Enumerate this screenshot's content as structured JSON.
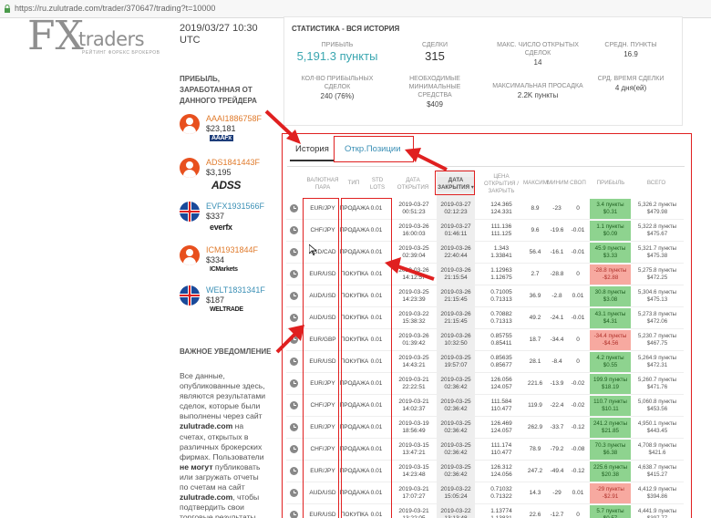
{
  "browser": {
    "url": "https://ru.zulutrade.com/trader/370647/trading?t=10000"
  },
  "logo": {
    "fx": "FX",
    "traders": "traders",
    "tagline": "РЕЙТИНГ ФОРЕКС БРОКЕРОВ"
  },
  "left": {
    "datetime": "2019/03/27 10:30 UTC",
    "profit_label": "ПРИБЫЛЬ, ЗАРАБОТАННАЯ ОТ ДАННОГО ТРЕЙДЕРА",
    "traders": [
      {
        "name": "AAAI1886758F",
        "amount": "$23,181",
        "broker": "AAAFx",
        "avatar": "user-avatar-icon"
      },
      {
        "name": "ADS1841443F",
        "amount": "$3,195",
        "broker": "ADSS",
        "avatar": "user-avatar-icon"
      },
      {
        "name": "EVFX1931566F",
        "amount": "$337",
        "broker": "everfx",
        "avatar": "flag-icon"
      },
      {
        "name": "ICM1931844F",
        "amount": "$334",
        "broker": "ICMarkets",
        "avatar": "user-avatar-icon"
      },
      {
        "name": "WELT1831341F",
        "amount": "$187",
        "broker": "WELTRADE",
        "avatar": "flag-icon"
      }
    ],
    "notice_title": "ВАЖНОЕ УВЕДОМЛЕНИЕ",
    "notice_parts": {
      "p1": "Все данные, опубликованные здесь, являются результатами сделок, которые были выполнены через сайт ",
      "site1": "zulutrade.com",
      "p2": " на счетах, открытых в различных брокерских фирмах. Пользователи ",
      "cannot": "не могут",
      "p3": " публиковать или загружать отчеты по счетам на сайт ",
      "site2": "zulutrade.com",
      "p4": ", чтобы подтвердить свои торговые результаты."
    }
  },
  "stats": {
    "title": "СТАТИСТИКА - ВСЯ ИСТОРИЯ",
    "profit_label": "ПРИБЫЛЬ",
    "profit_value": "5,191.3 пункты",
    "trades_label": "СДЕЛКИ",
    "trades_value": "315",
    "max_open_label": "МАКС. ЧИСЛО ОТКРЫТЫХ СДЕЛОК",
    "max_open_value": "14",
    "avg_pips_label": "СРЕДН. ПУНКТЫ",
    "avg_pips_value": "16.9",
    "profitable_label": "КОЛ-ВО ПРИБЫЛЬНЫХ СДЕЛОК",
    "profitable_value": "240 (76%)",
    "margin_label": "НЕОБХОДИМЫЕ МИНИМАЛЬНЫЕ СРЕДСТВА",
    "margin_value": "$409",
    "drawdown_label": "МАКСИМАЛЬНАЯ ПРОСАДКА",
    "drawdown_value": "2.2K пункты",
    "avg_time_label": "СРД. ВРЕМЯ СДЕЛКИ",
    "avg_time_value": "4 дня(ей)"
  },
  "tabs": {
    "history": "История",
    "open": "Откр.Позиции"
  },
  "columns": {
    "pair": "ВАЛЮТНАЯ ПАРА",
    "type": "ТИП",
    "lots": "STD LOTS",
    "open_date": "ДАТА ОТКРЫТИЯ",
    "close_date": "ДАТА ЗАКРЫТИЯ",
    "price": "ЦЕНА ОТКРЫТИЯ / ЗАКРЫТЬ",
    "max": "МАКСИМУМ",
    "min": "МИНИМУМ",
    "swap": "СВОП",
    "profit": "ПРИБЫЛЬ",
    "total": "ВСЕГО"
  },
  "rows": [
    {
      "pair": "EUR/JPY",
      "type": "ПРОДАЖА",
      "lots": "0.01",
      "open": "2019-03-27 00:51:23",
      "close": "2019-03-27 02:12:23",
      "price": "124.365 124.331",
      "max": "8.9",
      "min": "-23",
      "swap": "0",
      "pips": "3.4 пункты",
      "usd": "$0.31",
      "sign": "pos",
      "total_pips": "5,326.2 пункты",
      "total_usd": "$479.98"
    },
    {
      "pair": "CHF/JPY",
      "type": "ПРОДАЖА",
      "lots": "0.01",
      "open": "2019-03-26 16:00:03",
      "close": "2019-03-27 01:46:11",
      "price": "111.136 111.125",
      "max": "9.6",
      "min": "-19.6",
      "swap": "-0.01",
      "pips": "1.1 пункты",
      "usd": "$0.09",
      "sign": "pos",
      "total_pips": "5,322.8 пункты",
      "total_usd": "$475.67"
    },
    {
      "pair": "USD/CAD",
      "type": "ПРОДАЖА",
      "lots": "0.01",
      "open": "2019-03-25 02:39:04",
      "close": "2019-03-26 22:40:44",
      "price": "1.343 1.33841",
      "max": "56.4",
      "min": "-16.1",
      "swap": "-0.01",
      "pips": "45.9 пункты",
      "usd": "$3.33",
      "sign": "pos",
      "total_pips": "5,321.7 пункты",
      "total_usd": "$475.38"
    },
    {
      "pair": "EUR/USD",
      "type": "ПОКУПКА",
      "lots": "0.01",
      "open": "2019-03-26 14:12:57",
      "close": "2019-03-26 21:15:54",
      "price": "1.12963 1.12675",
      "max": "2.7",
      "min": "-28.8",
      "swap": "0",
      "pips": "-28.8 пункты",
      "usd": "-$2.88",
      "sign": "neg",
      "total_pips": "5,275.8 пункты",
      "total_usd": "$472.25"
    },
    {
      "pair": "AUD/USD",
      "type": "ПОКУПКА",
      "lots": "0.01",
      "open": "2019-03-25 14:23:39",
      "close": "2019-03-26 21:15:45",
      "price": "0.71005 0.71313",
      "max": "36.9",
      "min": "-2.8",
      "swap": "0.01",
      "pips": "30.8 пункты",
      "usd": "$3.08",
      "sign": "pos",
      "total_pips": "5,304.6 пункты",
      "total_usd": "$475.13"
    },
    {
      "pair": "AUD/USD",
      "type": "ПОКУПКА",
      "lots": "0.01",
      "open": "2019-03-22 15:38:32",
      "close": "2019-03-26 21:15:45",
      "price": "0.70882 0.71313",
      "max": "49.2",
      "min": "-24.1",
      "swap": "-0.01",
      "pips": "43.1 пункты",
      "usd": "$4.31",
      "sign": "pos",
      "total_pips": "5,273.8 пункты",
      "total_usd": "$472.06"
    },
    {
      "pair": "EUR/GBP",
      "type": "ПОКУПКА",
      "lots": "0.01",
      "open": "2019-03-26 01:39:42",
      "close": "2019-03-26 10:32:50",
      "price": "0.85755 0.85411",
      "max": "18.7",
      "min": "-34.4",
      "swap": "0",
      "pips": "-34.4 пункты",
      "usd": "-$4.56",
      "sign": "neg",
      "total_pips": "5,230.7 пункты",
      "total_usd": "$467.75"
    },
    {
      "pair": "EUR/USD",
      "type": "ПОКУПКА",
      "lots": "0.01",
      "open": "2019-03-25 14:43:21",
      "close": "2019-03-25 19:57:07",
      "price": "0.85635 0.85677",
      "max": "28.1",
      "min": "-8.4",
      "swap": "0",
      "pips": "4.2 пункты",
      "usd": "$0.55",
      "sign": "pos",
      "total_pips": "5,264.9 пункты",
      "total_usd": "$472.31"
    },
    {
      "pair": "EUR/JPY",
      "type": "ПРОДАЖА",
      "lots": "0.01",
      "open": "2019-03-21 22:22:51",
      "close": "2019-03-25 02:36:42",
      "price": "126.056 124.057",
      "max": "221.6",
      "min": "-13.9",
      "swap": "-0.02",
      "pips": "199.9 пункты",
      "usd": "$18.19",
      "sign": "pos",
      "total_pips": "5,260.7 пункты",
      "total_usd": "$471.76"
    },
    {
      "pair": "CHF/JPY",
      "type": "ПРОДАЖА",
      "lots": "0.01",
      "open": "2019-03-21 14:02:37",
      "close": "2019-03-25 02:36:42",
      "price": "111.584 110.477",
      "max": "119.9",
      "min": "-22.4",
      "swap": "-0.02",
      "pips": "110.7 пункты",
      "usd": "$10.11",
      "sign": "pos",
      "total_pips": "5,060.8 пункты",
      "total_usd": "$453.56"
    },
    {
      "pair": "EUR/JPY",
      "type": "ПРОДАЖА",
      "lots": "0.01",
      "open": "2019-03-19 18:56:49",
      "close": "2019-03-25 02:36:42",
      "price": "126.469 124.057",
      "max": "262.9",
      "min": "-33.7",
      "swap": "-0.12",
      "pips": "241.2 пункты",
      "usd": "$21.85",
      "sign": "pos",
      "total_pips": "4,950.1 пункты",
      "total_usd": "$443.45"
    },
    {
      "pair": "CHF/JPY",
      "type": "ПРОДАЖА",
      "lots": "0.01",
      "open": "2019-03-15 13:47:21",
      "close": "2019-03-25 02:36:42",
      "price": "111.174 110.477",
      "max": "78.9",
      "min": "-79.2",
      "swap": "-0.08",
      "pips": "70.3 пункты",
      "usd": "$6.38",
      "sign": "pos",
      "total_pips": "4,708.9 пункты",
      "total_usd": "$421.6"
    },
    {
      "pair": "EUR/JPY",
      "type": "ПРОДАЖА",
      "lots": "0.01",
      "open": "2019-03-15 14:23:48",
      "close": "2019-03-25 02:36:42",
      "price": "126.312 124.056",
      "max": "247.2",
      "min": "-49.4",
      "swap": "-0.12",
      "pips": "225.6 пункты",
      "usd": "$20.38",
      "sign": "pos",
      "total_pips": "4,638.7 пункты",
      "total_usd": "$415.27"
    },
    {
      "pair": "AUD/USD",
      "type": "ПРОДАЖА",
      "lots": "0.01",
      "open": "2019-03-21 17:07:27",
      "close": "2019-03-22 15:05:24",
      "price": "0.71032 0.71322",
      "max": "14.3",
      "min": "-29",
      "swap": "0.01",
      "pips": "-29 пункты",
      "usd": "-$2.91",
      "sign": "neg",
      "total_pips": "4,412.9 пункты",
      "total_usd": "$394.86"
    },
    {
      "pair": "EUR/USD",
      "type": "ПОКУПКА",
      "lots": "0.01",
      "open": "2019-03-21 13:22:05",
      "close": "2019-03-22 13:13:48",
      "price": "1.13774 1.13831",
      "max": "22.6",
      "min": "-12.7",
      "swap": "0",
      "pips": "5.7 пункты",
      "usd": "$0.57",
      "sign": "pos",
      "total_pips": "4,441.9 пункты",
      "total_usd": "$397.77"
    }
  ]
}
